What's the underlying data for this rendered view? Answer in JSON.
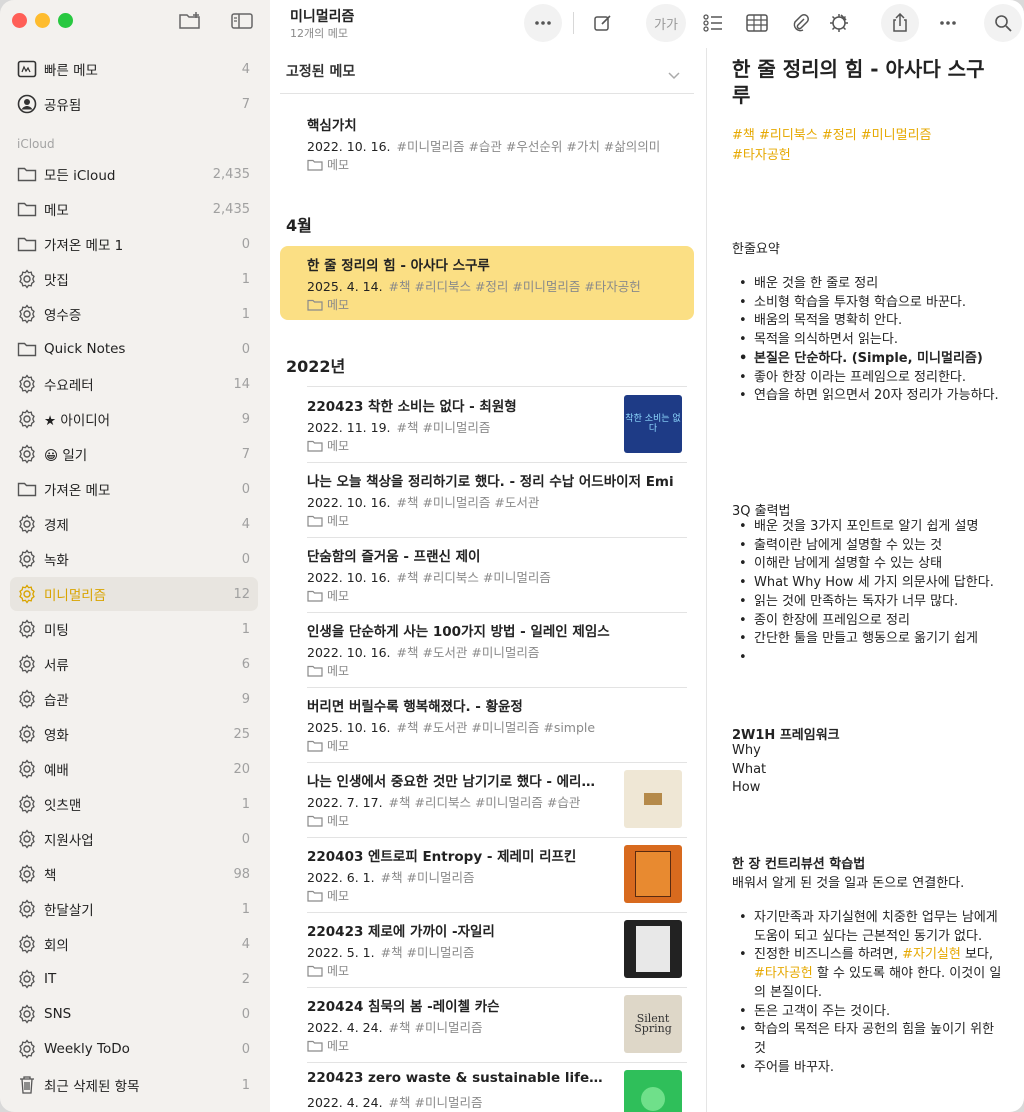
{
  "sidebar": {
    "section_label": "iCloud",
    "items": [
      {
        "label": "빠른 메모",
        "count": "4",
        "icon": "quick-note-icon"
      },
      {
        "label": "공유됨",
        "count": "7",
        "icon": "person-circle-icon"
      },
      {
        "label": "모든 iCloud",
        "count": "2,435",
        "icon": "folder-icon"
      },
      {
        "label": "메모",
        "count": "2,435",
        "icon": "folder-icon"
      },
      {
        "label": "가져온 메모 1",
        "count": "0",
        "icon": "folder-icon"
      },
      {
        "label": "맛집",
        "count": "1",
        "icon": "gear-icon"
      },
      {
        "label": "영수증",
        "count": "1",
        "icon": "gear-icon"
      },
      {
        "label": "Quick Notes",
        "count": "0",
        "icon": "folder-icon"
      },
      {
        "label": "수요레터",
        "count": "14",
        "icon": "gear-icon"
      },
      {
        "label": "★ 아이디어",
        "count": "9",
        "icon": "gear-icon"
      },
      {
        "label": "😀 일기",
        "count": "7",
        "icon": "gear-icon"
      },
      {
        "label": "가져온 메모",
        "count": "0",
        "icon": "folder-icon"
      },
      {
        "label": "경제",
        "count": "4",
        "icon": "gear-icon"
      },
      {
        "label": "녹화",
        "count": "0",
        "icon": "gear-icon"
      },
      {
        "label": "미니멀리즘",
        "count": "12",
        "icon": "gear-icon"
      },
      {
        "label": "미팅",
        "count": "1",
        "icon": "gear-icon"
      },
      {
        "label": "서류",
        "count": "6",
        "icon": "gear-icon"
      },
      {
        "label": "습관",
        "count": "9",
        "icon": "gear-icon"
      },
      {
        "label": "영화",
        "count": "25",
        "icon": "gear-icon"
      },
      {
        "label": "예배",
        "count": "20",
        "icon": "gear-icon"
      },
      {
        "label": "잇츠맨",
        "count": "1",
        "icon": "gear-icon"
      },
      {
        "label": "지원사업",
        "count": "0",
        "icon": "gear-icon"
      },
      {
        "label": "책",
        "count": "98",
        "icon": "gear-icon"
      },
      {
        "label": "한달살기",
        "count": "1",
        "icon": "gear-icon"
      },
      {
        "label": "회의",
        "count": "4",
        "icon": "gear-icon"
      },
      {
        "label": "IT",
        "count": "2",
        "icon": "gear-icon"
      },
      {
        "label": "SNS",
        "count": "0",
        "icon": "gear-icon"
      },
      {
        "label": "Weekly ToDo",
        "count": "0",
        "icon": "gear-icon"
      },
      {
        "label": "최근 삭제된 항목",
        "count": "1",
        "icon": "trash-icon"
      }
    ]
  },
  "toolbar": {
    "folder_title": "미니멀리즘",
    "folder_subtitle": "12개의 메모",
    "format_label": "가가"
  },
  "list": {
    "pinned_header": "고정된 메모",
    "group_april": "4월",
    "group_2022": "2022년",
    "folder_label": "메모",
    "pinned": [
      {
        "title": "핵심가치",
        "date": "2022. 10. 16.",
        "tags": "#미니멀리즘 #습관 #우선순위 #가치 #삶의의미"
      }
    ],
    "april": [
      {
        "title": "한 줄 정리의 힘 - 아사다 스구루",
        "date": "2025. 4. 14.",
        "tags": "#책 #리디북스 #정리 #미니멀리즘 #타자공헌"
      }
    ],
    "y2022": [
      {
        "title": "220423 착한 소비는 없다 - 최원형",
        "date": "2022. 11. 19.",
        "tags": "#책 #미니멀리즘"
      },
      {
        "title": "나는 오늘 책상을 정리하기로 했다. - 정리 수납 어드바이저 Emi",
        "date": "2022. 10. 16.",
        "tags": "#책 #미니멀리즘 #도서관"
      },
      {
        "title": "단숨함의 즐거움 - 프랜신 제이",
        "date": "2022. 10. 16.",
        "tags": "#책 #리디북스 #미니멀리즘"
      },
      {
        "title": "인생을 단순하게 사는 100가지 방법 - 일레인 제임스",
        "date": "2022. 10. 16.",
        "tags": "#책 #도서관 #미니멀리즘"
      },
      {
        "title": "버리면 버릴수록 행복해졌다. - 황윤정",
        "date": "2025. 10. 16.",
        "tags": "#책 #도서관 #미니멀리즘 #simple"
      },
      {
        "title": "나는 인생에서 중요한 것만 남기기로 했다 - 에리카…",
        "date": "2022. 7. 17.",
        "tags": "#책 #리디북스 #미니멀리즘 #습관"
      },
      {
        "title": "220403 엔트로피 Entropy - 제레미 리프킨",
        "date": "2022. 6. 1.",
        "tags": "#책 #미니멀리즘"
      },
      {
        "title": "220423 제로에 가까이 -자일리",
        "date": "2022. 5. 1.",
        "tags": "#책 #미니멀리즘"
      },
      {
        "title": "220424 침묵의 봄 -레이첼 카슨",
        "date": "2022. 4. 24.",
        "tags": "#책 #미니멀리즘"
      },
      {
        "title": "220423 zero waste & sustainable lifesty…",
        "date": "2022. 4. 24.",
        "tags": "#책 #미니멀리즘"
      }
    ],
    "thumb_texts": {
      "t1": "착한 소비는 없다",
      "t2": "Silent Spring"
    }
  },
  "editor": {
    "title": "한 줄 정리의 힘 - 아사다 스구루",
    "tags_line1": "#책 #리디북스  #정리 #미니멀리즘",
    "tags_line2": "#타자공헌",
    "s1_heading": "한줄요약",
    "s1_items": [
      "배운 것을 한 줄로 정리",
      "소비형 학습을 투자형 학습으로 바꾼다.",
      "배움의 목적을 명확히 안다.",
      "목적을 의식하면서 읽는다.",
      "본질은 단순하다. (Simple, 미니멀리즘)",
      "좋아 한장 이라는 프레임으로 정리한다.",
      "연습을 하면 읽으면서 20자 정리가 가능하다."
    ],
    "s2_heading": "3Q 출력법",
    "s2_items": [
      "배운 것을 3가지 포인트로 알기 쉽게 설명",
      "출력이란 남에게 설명할 수 있는 것",
      "이해란 남에게 설명할 수 있는 상태",
      "What Why How 세 가지 의문사에 답한다.",
      "읽는 것에 만족하는 독자가 너무 많다.",
      "종이 한장에 프레임으로 정리",
      "간단한 툴을 만들고 행동으로 옮기기 쉽게",
      ""
    ],
    "s3_heading": "2W1H 프레임워크",
    "s3_lines": [
      "Why",
      "What",
      "How"
    ],
    "s4_heading": "한 장 컨트리뷰션 학습법",
    "s4_intro": "배워서 알게 된 것을 일과 돈으로 연결한다.",
    "s4_item1": "자기만족과 자기실현에 치중한 업무는 남에게 도움이 되고 싶다는 근본적인 동기가 없다.",
    "s4_item2_a": "진정한 비즈니스를 하려면, ",
    "s4_item2_tag1": "#자기실현",
    "s4_item2_b": " 보다, ",
    "s4_item2_tag2": "#타자공헌",
    "s4_item2_c": " 할 수 있도록 해야 한다. 이것이 일의 본질이다.",
    "s4_item3": "돈은 고객이 주는 것이다.",
    "s4_item4": "학습의 목적은 타자 공헌의 힘을 높이기 위한 것",
    "s4_item5": "주어를 바꾸자."
  },
  "colors": {
    "accent": "#e6a800",
    "selection": "#fbdf84",
    "sidebar_bg": "#f3f1ee"
  }
}
